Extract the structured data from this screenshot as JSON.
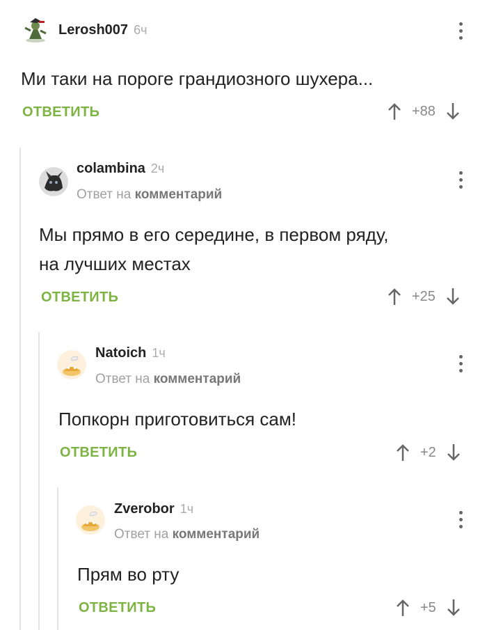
{
  "comments": [
    {
      "author": "Lerosh007",
      "time": "6ч",
      "text": "Ми таки на пороге грандиозного шухера...",
      "reply_label": "ОТВЕТИТЬ",
      "score": "+88"
    },
    {
      "author": "colambina",
      "time": "2ч",
      "reply_to_prefix": "Ответ на",
      "reply_to_link": "комментарий",
      "text_line1": "Мы прямо в его середине, в первом ряду,",
      "text_line2": "на лучших местах",
      "reply_label": "ОТВЕТИТЬ",
      "score": "+25"
    },
    {
      "author": "Natoich",
      "time": "1ч",
      "reply_to_prefix": "Ответ на",
      "reply_to_link": "комментарий",
      "text": "Попкорн приготовиться сам!",
      "reply_label": "ОТВЕТИТЬ",
      "score": "+2"
    },
    {
      "author": "Zverobor",
      "time": "1ч",
      "reply_to_prefix": "Ответ на",
      "reply_to_link": "комментарий",
      "text": "Прям во рту",
      "reply_label": "ОТВЕТИТЬ",
      "score": "+5"
    }
  ],
  "colors": {
    "accent": "#7cb342",
    "muted": "#a0a0a0",
    "text": "#222222"
  }
}
